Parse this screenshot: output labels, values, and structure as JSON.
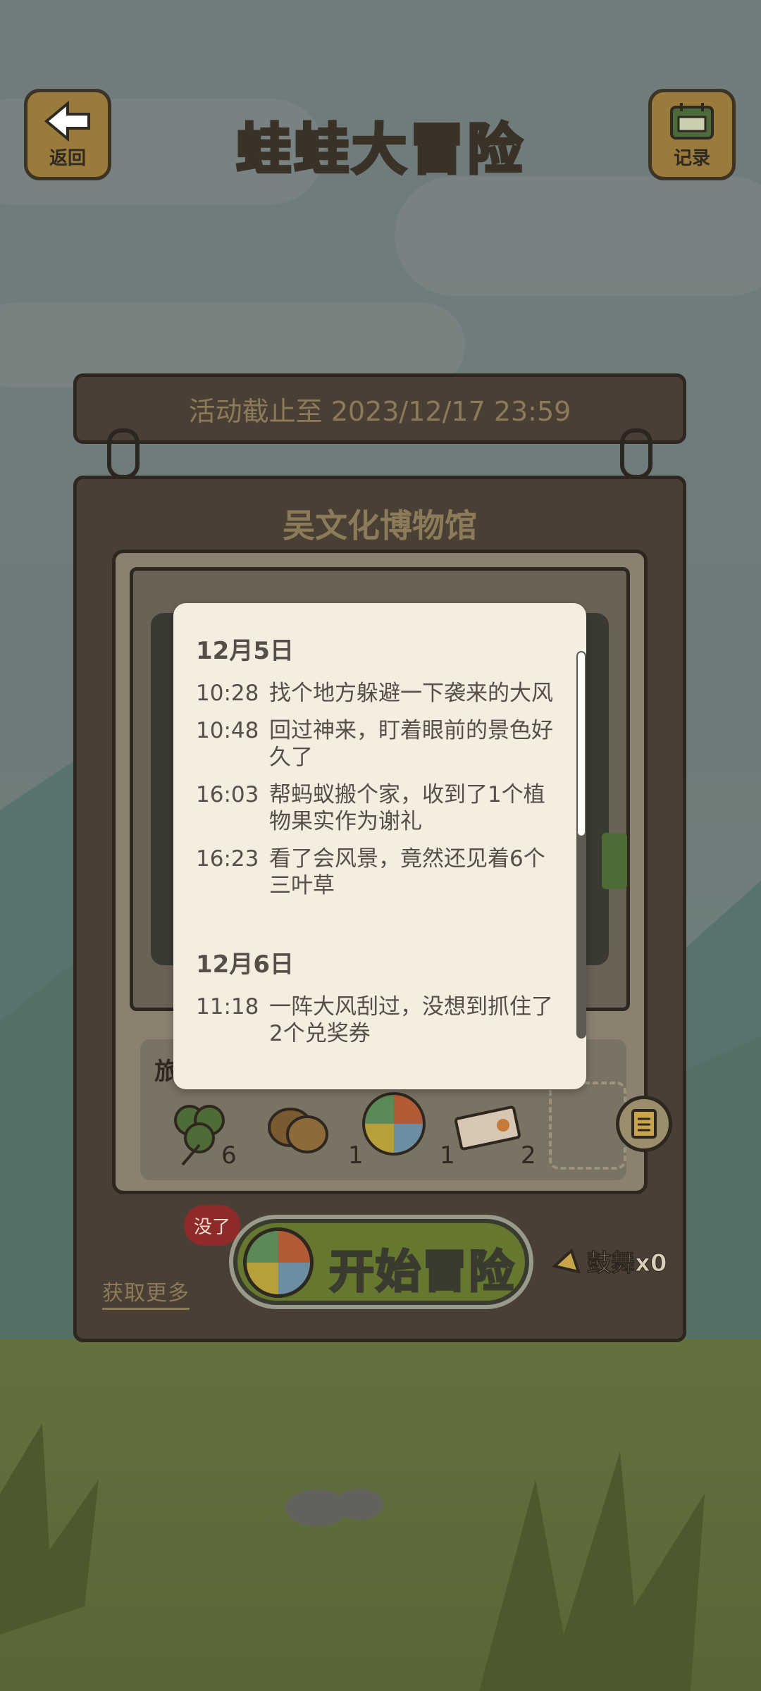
{
  "header": {
    "title": "蛙蛙大冒险",
    "back_label": "返回",
    "records_label": "记录"
  },
  "event": {
    "deadline": "活动截止至 2023/12/17 23:59",
    "location": "吴文化博物馆"
  },
  "inventory": {
    "items": [
      {
        "icon": "clover-icon",
        "count": "6"
      },
      {
        "icon": "acorn-icon",
        "count": "1"
      },
      {
        "icon": "spinner-wheel-icon",
        "count": "1"
      },
      {
        "icon": "ticket-icon",
        "count": "2"
      }
    ],
    "partial_label": "旅"
  },
  "actions": {
    "start_label": "开始冒险",
    "none_badge": "没了",
    "get_more": "获取更多",
    "cheer_label": "鼓舞x0"
  },
  "log": {
    "days": [
      {
        "date": "12月5日",
        "entries": [
          {
            "time": "10:28",
            "text": "找个地方躲避一下袭来的大风"
          },
          {
            "time": "10:48",
            "text": "回过神来，盯着眼前的景色好久了"
          },
          {
            "time": "16:03",
            "text": "帮蚂蚁搬个家，收到了1个植物果实作为谢礼"
          },
          {
            "time": "16:23",
            "text": "看了会风景，竟然还见着6个三叶草"
          }
        ]
      },
      {
        "date": "12月6日",
        "entries": [
          {
            "time": "11:18",
            "text": "一阵大风刮过，没想到抓住了2个兑奖券"
          }
        ]
      }
    ]
  }
}
